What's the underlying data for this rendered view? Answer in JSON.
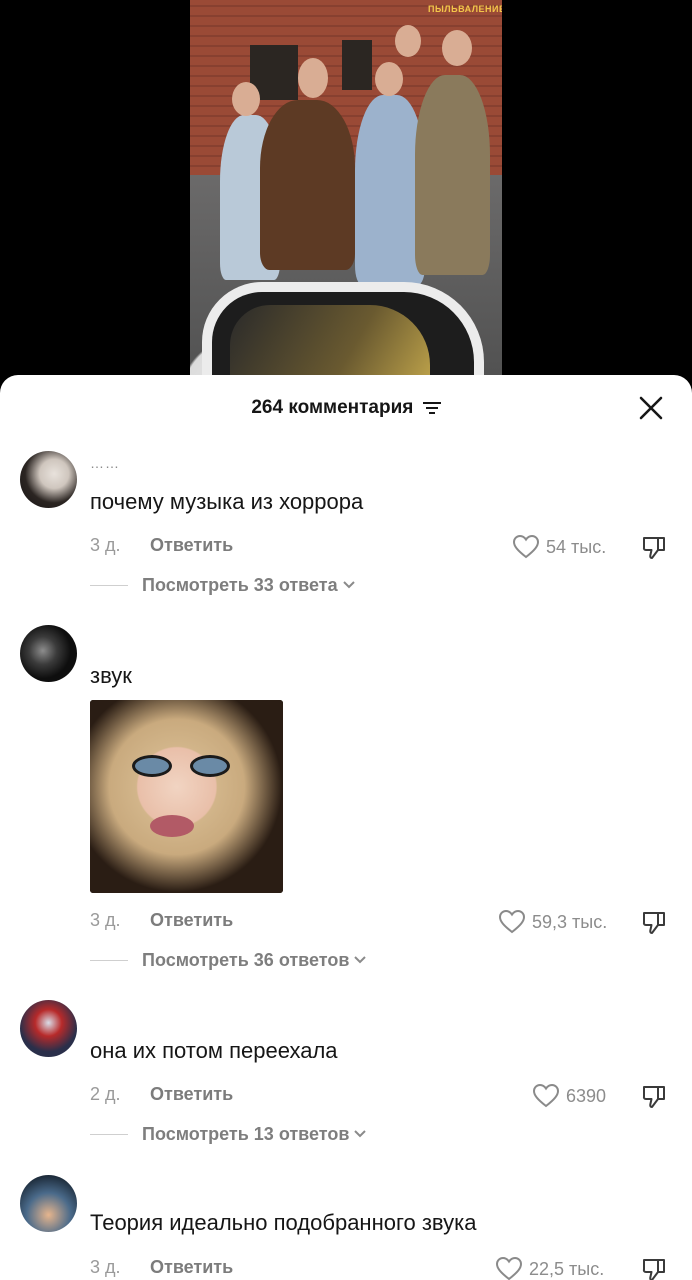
{
  "video": {
    "sign_text": "ПЫЛЬВАЛЕНИЕ"
  },
  "sheet": {
    "title": "264 комментария",
    "filter_icon": "sort-lines-icon",
    "close_icon": "close-x-icon"
  },
  "comments": [
    {
      "username": "……",
      "text": "почему музыка из хоррора",
      "age": "3 д.",
      "reply": "Ответить",
      "likes": "54 тыс.",
      "view_replies": "Посмотреть 33 ответа"
    },
    {
      "username": "",
      "text": "звук",
      "age": "3 д.",
      "reply": "Ответить",
      "likes": "59,3 тыс.",
      "view_replies": "Посмотреть 36 ответов"
    },
    {
      "username": "",
      "text": "она их потом переехала",
      "age": "2 д.",
      "reply": "Ответить",
      "likes": "6390",
      "view_replies": "Посмотреть 13 ответов"
    },
    {
      "username": "",
      "text": "Теория идеально подобранного звука",
      "age": "3 д.",
      "reply": "Ответить",
      "likes": "22,5 тыс."
    }
  ],
  "colors": {
    "text_primary": "#161616",
    "text_secondary": "#8c8c8c",
    "sheet_bg": "#ffffff",
    "backdrop": "#000000"
  }
}
